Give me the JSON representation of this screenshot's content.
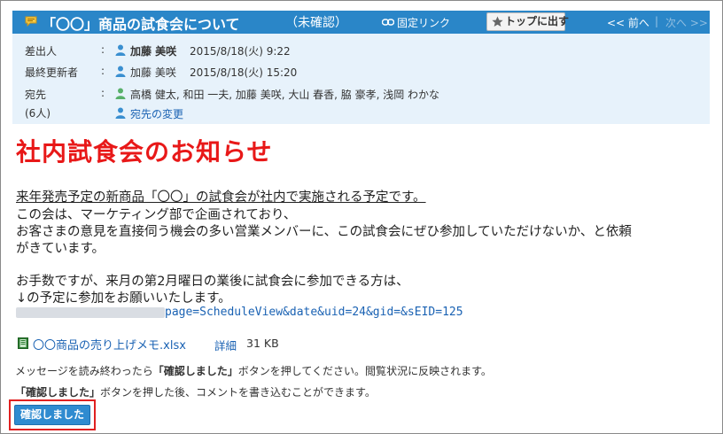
{
  "header": {
    "title": "「〇〇」商品の試食会について",
    "status": "（未確認）",
    "permalink_label": "固定リンク",
    "top_button_label": "トップに出す",
    "prev_label": "<< 前へ",
    "separator": "|",
    "next_label": "次へ >>"
  },
  "meta": {
    "sender_label": "差出人",
    "sender_name": "加藤 美咲",
    "sender_date": "2015/8/18(火) 9:22",
    "updater_label": "最終更新者",
    "updater_name": "加藤 美咲",
    "updater_date": "2015/8/18(火) 15:20",
    "recipients_label": "宛先",
    "recipients_count": "(6人)",
    "colon": ":",
    "recipients": "高橋 健太, 和田 一夫, 加藤 美咲, 大山 春香, 脇 豪孝, 浅岡 わかな",
    "change_recipients_label": "宛先の変更"
  },
  "message": {
    "headline": "社内試食会のお知らせ",
    "line1": "来年発売予定の新商品「〇〇」の試食会が社内で実施される予定です。",
    "line2": "この会は、マーケティング部で企画されており、",
    "line3": "お客さまの意見を直接伺う機会の多い営業メンバーに、この試食会にぜひ参加していただけないか、と依頼",
    "line4": "がきています。",
    "line5": "お手数ですが、来月の第2月曜日の業後に試食会に参加できる方は、",
    "line6": "↓の予定に参加をお願いいたします。",
    "url_visible": "page=ScheduleView&date&uid=24&gid=&sEID=125"
  },
  "attachment": {
    "filename": "〇〇商品の売り上げメモ.xlsx",
    "detail_label": "詳細",
    "size": "31 KB"
  },
  "notices": {
    "n1_pre": "メッセージを読み終わったら",
    "n1_bold": "「確認しました」",
    "n1_post": "ボタンを押してください。閲覧状況に反映されます。",
    "n2_bold": "「確認しました」",
    "n2_post": "ボタンを押した後、コメントを書き込むことができます。"
  },
  "confirm_button_label": "確認しました",
  "colors": {
    "header_bg": "#2a86c8",
    "meta_bg": "#e7f2fb",
    "headline": "#e81818",
    "link": "#1a62b3",
    "confirm_bg": "#2f8bd0",
    "highlight_border": "#e02020"
  }
}
